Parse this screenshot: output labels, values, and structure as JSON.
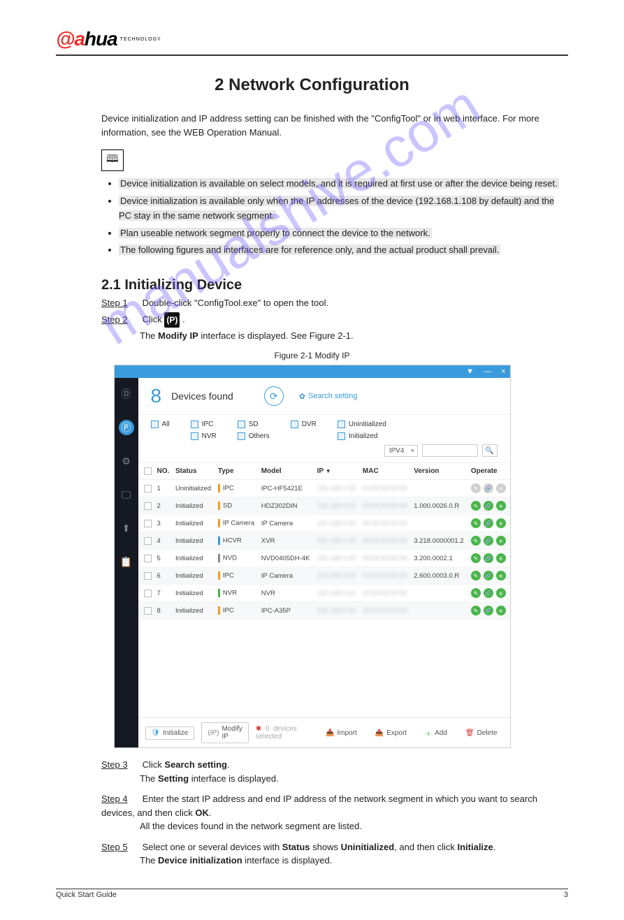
{
  "logo": {
    "part1": "a",
    "part2": "hua",
    "sub": "TECHNOLOGY"
  },
  "chapter_title": "2 Network Configuration",
  "intro": "Device initialization and IP address setting can be finished with the \"ConfigTool\" or in web interface. For more information, see the WEB Operation Manual.",
  "notes": [
    {
      "text_parts": [
        "Device initialization is available on select models, and it is required at first use or after the device being reset."
      ]
    },
    {
      "text_parts": [
        "Device initialization is available only when the IP addresses of the device (192.168.1.108 by default) and the PC stay in the same network segment."
      ]
    },
    {
      "text_parts": [
        "Plan useable network segment properly to connect the device to the network."
      ]
    },
    {
      "text_parts": [
        "The following figures and interfaces are for reference only, and the actual product shall prevail."
      ]
    }
  ],
  "section_2_1_title": "2.1 Initializing Device",
  "step1": {
    "label": "Step 1",
    "body_pre": "Double-click \"ConfigTool.exe\" to open the tool."
  },
  "step2": {
    "label": "Step 2",
    "body_pre": "Click ",
    "body_post": ".",
    "interface_line": "The Modify IP interface is displayed. See Figure 2-1."
  },
  "figure_caption": "Figure 2-1 Modify IP",
  "configtool": {
    "window_controls": [
      "▼",
      "—",
      "×"
    ],
    "count": "8",
    "found_label": "Devices found",
    "search_setting": "Search setting",
    "filters_row1": [
      "All",
      "IPC",
      "SD",
      "DVR"
    ],
    "filters_row2": [
      "NVR",
      "Others"
    ],
    "status_filters": [
      "Uninitialized",
      "Initialized"
    ],
    "ip_version": "IPV4",
    "table": {
      "headers": [
        "",
        "NO.",
        "Status",
        "Type",
        "Model",
        "IP",
        "MAC",
        "Version",
        "Operate"
      ],
      "rows": [
        {
          "no": "1",
          "status": "Uninitialized",
          "type": "IPC",
          "type_color": "#f59a23",
          "model": "IPC-HF5421E",
          "version": "",
          "ops": "grey"
        },
        {
          "no": "2",
          "status": "Initialized",
          "type": "SD",
          "type_color": "#f59a23",
          "model": "HDZ302DIN",
          "version": "1.000.0026.0.R",
          "ops": "green",
          "stripe": true
        },
        {
          "no": "3",
          "status": "Initialized",
          "type": "IP Camera",
          "type_color": "#f59a23",
          "model": "IP Camera",
          "version": "",
          "ops": "green"
        },
        {
          "no": "4",
          "status": "Initialized",
          "type": "HCVR",
          "type_color": "#3a9bdc",
          "model": "XVR",
          "version": "3.218.0000001.2",
          "ops": "green",
          "stripe": true
        },
        {
          "no": "5",
          "status": "Initialized",
          "type": "NVD",
          "type_color": "#888",
          "model": "NVD0405DH-4K",
          "version": "3.200.0002.1",
          "ops": "green"
        },
        {
          "no": "6",
          "status": "Initialized",
          "type": "IPC",
          "type_color": "#f59a23",
          "model": "IP Camera",
          "version": "2.600.0003.0.R",
          "ops": "green",
          "stripe": true
        },
        {
          "no": "7",
          "status": "Initialized",
          "type": "NVR",
          "type_color": "#4ab54a",
          "model": "NVR",
          "version": "",
          "ops": "green"
        },
        {
          "no": "8",
          "status": "Initialized",
          "type": "IPC",
          "type_color": "#f59a23",
          "model": "IPC-A35P",
          "version": "",
          "ops": "green",
          "stripe": true
        }
      ]
    },
    "footer": {
      "initialize": "Initialize",
      "modify_ip": "Modify IP",
      "selected_prefix": "0",
      "selected_suffix": "devices selected",
      "import": "Import",
      "export": "Export",
      "add": "Add",
      "delete": "Delete"
    }
  },
  "step3": {
    "label": "Step 3",
    "body": "Click Search setting.",
    "after": "The Setting interface is displayed."
  },
  "step4": {
    "label": "Step 4",
    "body": "Enter the start IP address and end IP address of the network segment in which you want to search devices, and then click OK.",
    "after": "All the devices found in the network segment are listed."
  },
  "step5": {
    "label": "Step 5",
    "body": "Select one or several devices with Status shows Uninitialized, and then click Initialize.",
    "after": "The Device initialization interface is displayed."
  },
  "footer": {
    "left": "Quick Start Guide",
    "right": "3"
  },
  "watermark": "manualshive.com"
}
